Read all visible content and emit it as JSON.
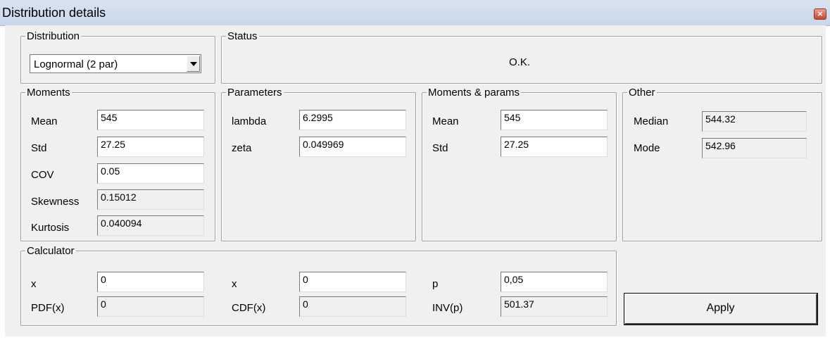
{
  "window": {
    "title": "Distribution details"
  },
  "distribution": {
    "legend": "Distribution",
    "selected": "Lognormal (2 par)"
  },
  "status": {
    "legend": "Status",
    "text": "O.K."
  },
  "moments": {
    "legend": "Moments",
    "rows": [
      {
        "label": "Mean",
        "value": "545"
      },
      {
        "label": "Std",
        "value": "27.25"
      },
      {
        "label": "COV",
        "value": "0.05"
      },
      {
        "label": "Skewness",
        "value": "0.15012"
      },
      {
        "label": "Kurtosis",
        "value": "0.040094"
      }
    ]
  },
  "parameters": {
    "legend": "Parameters",
    "rows": [
      {
        "label": "lambda",
        "value": "6.2995"
      },
      {
        "label": "zeta",
        "value": "0.049969"
      }
    ]
  },
  "moments_params": {
    "legend": "Moments & params",
    "rows": [
      {
        "label": "Mean",
        "value": "545"
      },
      {
        "label": "Std",
        "value": "27.25"
      }
    ]
  },
  "other": {
    "legend": "Other",
    "rows": [
      {
        "label": "Median",
        "value": "544.32"
      },
      {
        "label": "Mode",
        "value": "542.96"
      }
    ]
  },
  "calculator": {
    "legend": "Calculator",
    "pdf": {
      "x_label": "x",
      "x_value": "0",
      "out_label": "PDF(x)",
      "out_value": "0"
    },
    "cdf": {
      "x_label": "x",
      "x_value": "0",
      "out_label": "CDF(x)",
      "out_value": "0"
    },
    "inv": {
      "p_label": "p",
      "p_value": "0,05",
      "out_label": "INV(p)",
      "out_value": "501.37"
    }
  },
  "buttons": {
    "apply": "Apply"
  }
}
